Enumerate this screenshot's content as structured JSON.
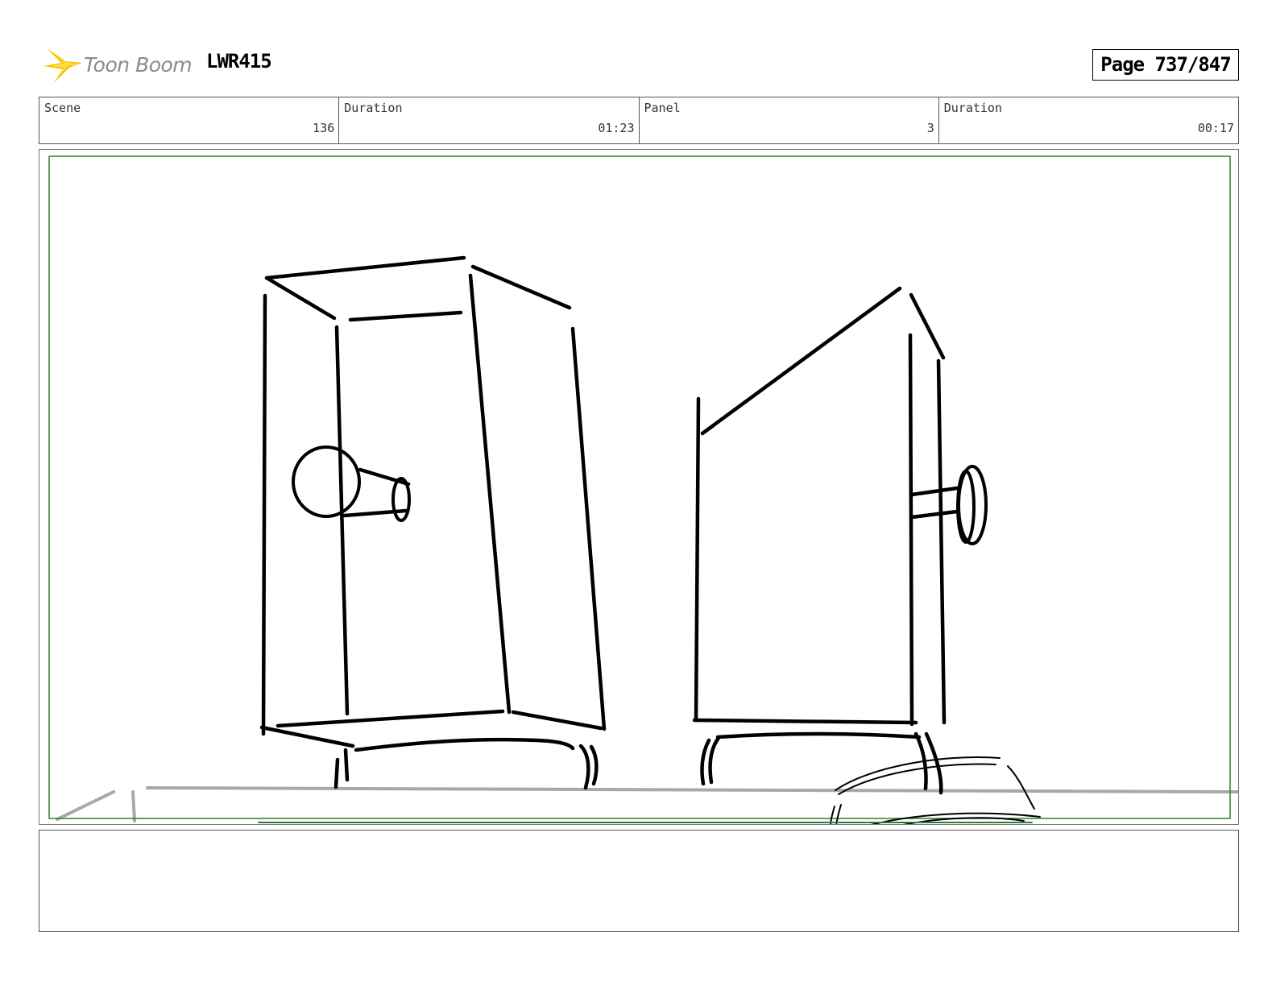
{
  "header": {
    "logo_text": "Toon Boom",
    "project_code": "LWR415",
    "page_label": "Page 737/847"
  },
  "info_bar": {
    "scene_label": "Scene",
    "scene_value": "136",
    "scene_duration_label": "Duration",
    "scene_duration_value": "01:23",
    "panel_label": "Panel",
    "panel_value": "3",
    "panel_duration_label": "Duration",
    "panel_duration_value": "00:17"
  },
  "notes": {
    "text": ""
  },
  "colors": {
    "safe_frame": "#2e7d32",
    "sketch_line": "#000000",
    "floor_line": "#a8a8a8",
    "logo_star": "#f5c400"
  }
}
